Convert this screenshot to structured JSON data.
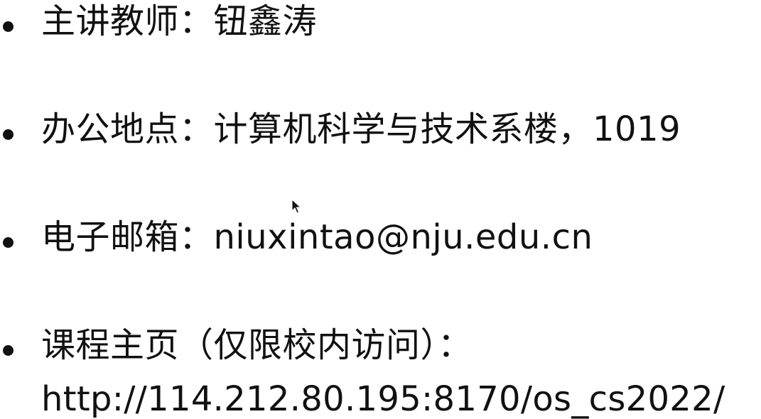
{
  "items": [
    {
      "text": "主讲教师：钮鑫涛"
    },
    {
      "text": "办公地点：计算机科学与技术系楼，1019"
    },
    {
      "text": "电子邮箱：niuxintao@nju.edu.cn"
    },
    {
      "text": "课程主页（仅限校内访问）：",
      "line2": "http://114.212.80.195:8170/os_cs2022/"
    }
  ],
  "icons": {
    "bullet": "bullet-dot",
    "cursor": "mouse-pointer-icon"
  }
}
